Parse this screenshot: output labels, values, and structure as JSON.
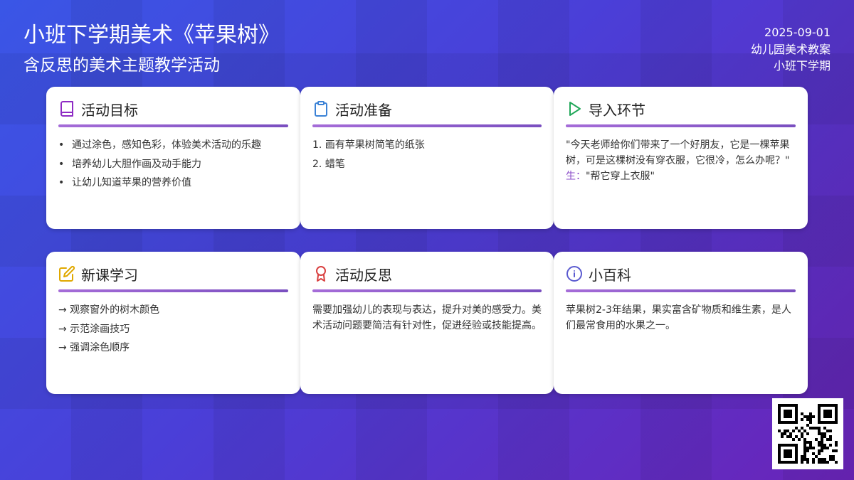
{
  "header": {
    "title": "小班下学期美术《苹果树》",
    "subtitle": "含反思的美术主题教学活动",
    "date": "2025-09-01",
    "category": "幼儿园美术教案",
    "grade": "小班下学期"
  },
  "cards": {
    "goals": {
      "title": "活动目标",
      "icon": "book-icon",
      "items": [
        "通过涂色，感知色彩，体验美术活动的乐趣",
        "培养幼儿大胆作画及动手能力",
        "让幼儿知道苹果的营养价值"
      ]
    },
    "prep": {
      "title": "活动准备",
      "icon": "clipboard-icon",
      "items": [
        "1. 画有苹果树简笔的纸张",
        "2. 蜡笔"
      ]
    },
    "intro": {
      "title": "导入环节",
      "icon": "play-icon",
      "quote": "\"今天老师给你们带来了一个好朋友，它是一棵苹果树，可是这棵树没有穿衣服，它很冷，怎么办呢？\"",
      "speaker": "生：",
      "answer": "\"帮它穿上衣服\""
    },
    "learn": {
      "title": "新课学习",
      "icon": "edit-icon",
      "items": [
        "→ 观察窗外的树木颜色",
        "→ 示范涂画技巧",
        "→ 强调涂色顺序"
      ]
    },
    "reflect": {
      "title": "活动反思",
      "icon": "award-icon",
      "text": "需要加强幼儿的表现与表达，提升对美的感受力。美术活动问题要简洁有针对性，促进经验或技能提高。"
    },
    "wiki": {
      "title": "小百科",
      "icon": "info-icon",
      "text": "苹果树2-3年结果，果实富含矿物质和维生素，是人们最常食用的水果之一。"
    }
  },
  "colors": {
    "book": "#8e2bc4",
    "clipboard": "#3b82d6",
    "play": "#22a85a",
    "edit": "#e0a800",
    "award": "#d94040",
    "info": "#5a5ad0"
  }
}
